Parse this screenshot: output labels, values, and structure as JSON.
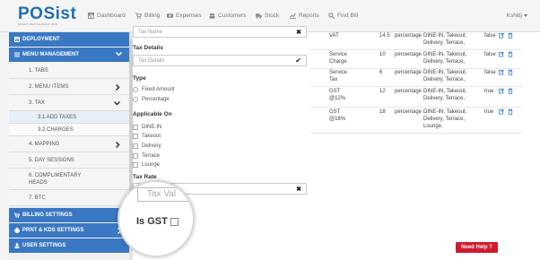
{
  "app": {
    "logo": "POSist",
    "logo_sub": "SMART RESTAURANT POS"
  },
  "nav": [
    {
      "label": "Dashboard",
      "icon": "dashboard-icon"
    },
    {
      "label": "Billing",
      "icon": "cart-icon"
    },
    {
      "label": "Expenses",
      "icon": "money-icon"
    },
    {
      "label": "Customers",
      "icon": "users-icon"
    },
    {
      "label": "Stock",
      "icon": "truck-icon"
    },
    {
      "label": "Reports",
      "icon": "chart-icon"
    },
    {
      "label": "Find Bill",
      "icon": "search-icon"
    }
  ],
  "user": "Kshitij",
  "sidebar": {
    "deployment": "DEPLOYMENT",
    "menu_management": "MENU MANAGEMENT",
    "items": {
      "tabs": "1. TABS",
      "menu_items": "2. MENU ITEMS",
      "tax": "3. TAX",
      "add_taxes": "3.1 ADD TAXES",
      "charges": "3.2 CHARGES",
      "mapping": "4. MAPPING",
      "day_sessions": "5. DAY SESSIONS",
      "complimentary_heads": "6. COMPLIMENTARY HEADS",
      "btc": "7. BTC"
    },
    "billing_settings": "BILLING SETTINGS",
    "prnt_kds": "PRNT & KDS SETTINGS",
    "user_settings": "USER SETTINGS"
  },
  "form": {
    "tax_name_placeholder": "Tax Name",
    "tax_details_label": "Tax Details",
    "tax_details_placeholder": "Tax Details",
    "type_label": "Type",
    "type_options": [
      "Fixed Amount",
      "Percentage"
    ],
    "applicable_label": "Applicable On",
    "applicable_options": [
      "DINE-IN",
      "Takeout",
      "Delivery",
      "Terrace",
      "Lounge"
    ],
    "tax_rate_label": "Tax Rate",
    "tax_value_placeholder": "Tax Val",
    "is_gst_label": "Is GST"
  },
  "taxes": [
    {
      "name": "VAT",
      "rate": "14.5",
      "type": "percentage",
      "applicable": "DINE-IN, Takeout, Delivery, Terrace,",
      "gst": "false"
    },
    {
      "name": "Service Charge",
      "rate": "10",
      "type": "percentage",
      "applicable": "DINE-IN, Takeout, Delivery, Terrace,",
      "gst": "false"
    },
    {
      "name": "Service Tax",
      "rate": "6",
      "type": "percentage",
      "applicable": "DINE-IN, Takeout, Delivery, Terrace,",
      "gst": "false"
    },
    {
      "name": "GST @12%",
      "rate": "12",
      "type": "percentage",
      "applicable": "DINE-IN, Takeout, Delivery, Terrace,",
      "gst": "true"
    },
    {
      "name": "GST @18%",
      "rate": "18",
      "type": "percentage",
      "applicable": "DINE-IN, Takeout, Delivery, Terrace, Lounge,",
      "gst": "true"
    }
  ],
  "help_button": "Need Help ?",
  "colors": {
    "brand_blue": "#3a78c3",
    "help_red": "#d0192f",
    "icon_blue": "#2f7bd2"
  }
}
